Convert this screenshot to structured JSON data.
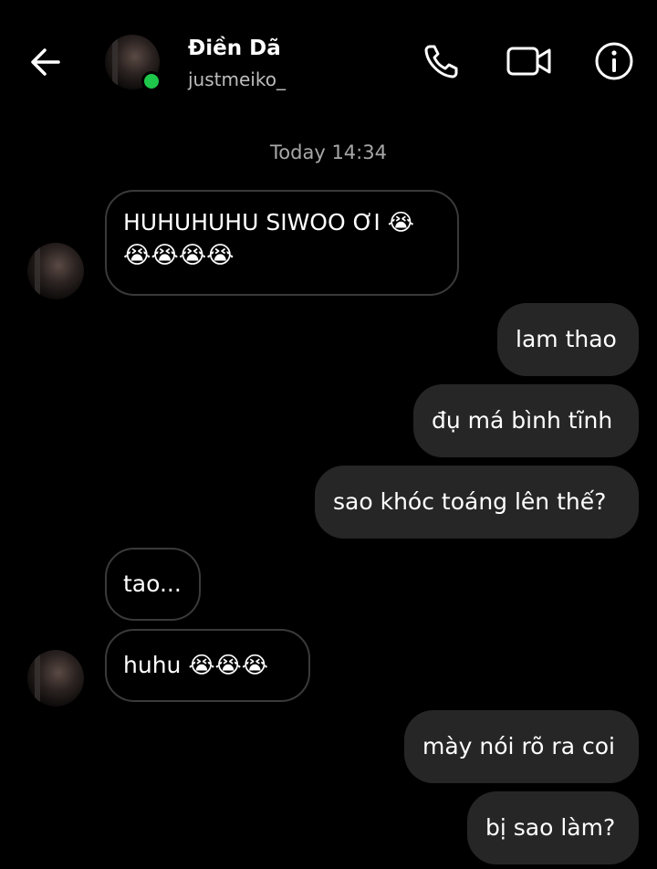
{
  "header": {
    "contact_name": "Điền Dã",
    "contact_handle": "justmeiko_"
  },
  "timestamp": "Today 14:34",
  "messages": [
    {
      "direction": "in",
      "text_line1": "HUHUHUHU SIWOO ƠI 😭",
      "text_line2": "😭😭😭😭"
    },
    {
      "direction": "out",
      "text": "lam thao"
    },
    {
      "direction": "out",
      "text": "đụ má bình tĩnh"
    },
    {
      "direction": "out",
      "text": "sao khóc toáng lên thế?"
    },
    {
      "direction": "in",
      "text": "tao..."
    },
    {
      "direction": "in",
      "text": "huhu 😭😭😭"
    },
    {
      "direction": "out",
      "text": "mày nói rõ ra coi"
    },
    {
      "direction": "out",
      "text": "bị sao làm?"
    }
  ],
  "icons": {
    "back": "arrow-left-icon",
    "call": "phone-icon",
    "video": "video-camera-icon",
    "info": "info-icon"
  },
  "colors": {
    "background": "#000000",
    "outgoing_bubble": "#262626",
    "incoming_border": "#3a3a3a",
    "online": "#1ec84a"
  }
}
